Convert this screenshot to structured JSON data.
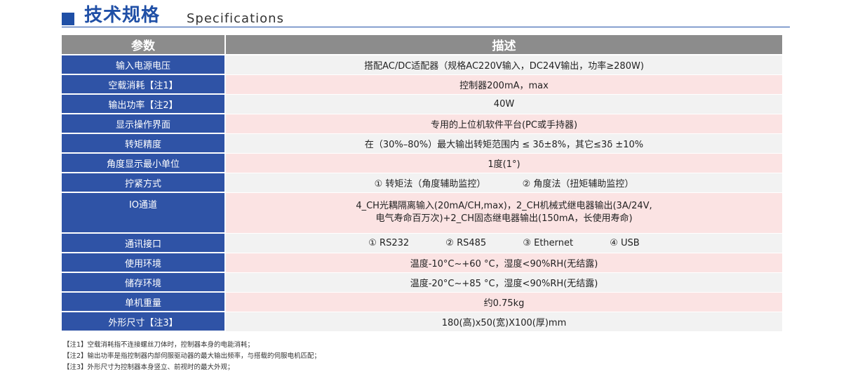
{
  "header": {
    "title_cn": "技术规格",
    "title_en": "Specifications"
  },
  "table": {
    "col_param": "参数",
    "col_desc": "描述",
    "rows": [
      {
        "param": "输入电源电压",
        "desc": "搭配AC/DC适配器（规格AC220V输入，DC24V输出，功率≥280W)"
      },
      {
        "param": "空载消耗【注1】",
        "desc": "控制器200mA，max"
      },
      {
        "param": "输出功率【注2】",
        "desc": "40W"
      },
      {
        "param": "显示操作界面",
        "desc": "专用的上位机软件平台(PC或手持器)"
      },
      {
        "param": "转矩精度",
        "desc": "在（30%–80%）最大输出转矩范围内 ≤ 3δ±8%，其它≤3δ ±10%"
      },
      {
        "param": "角度显示最小单位",
        "desc": "1度(1°)"
      },
      {
        "param": "拧紧方式",
        "options": [
          "① 转矩法（角度辅助监控）",
          "② 角度法（扭矩辅助监控）"
        ]
      },
      {
        "param": "IO通道",
        "desc_lines": [
          "4_CH光耦隔离输入(20mA/CH,max)，2_CH机械式继电器输出(3A/24V,",
          "电气寿命百万次)+2_CH固态继电器输出(150mA，长使用寿命)"
        ]
      },
      {
        "param": "通讯接口",
        "options": [
          "① RS232",
          "② RS485",
          "③ Ethernet",
          "④ USB"
        ]
      },
      {
        "param": "使用环境",
        "desc": "温度-10°C~+60 °C，湿度<90%RH(无结露)"
      },
      {
        "param": "储存环境",
        "desc": "温度-20°C~+85 °C，湿度<90%RH(无结露)"
      },
      {
        "param": "单机重量",
        "desc": "约0.75kg"
      },
      {
        "param": "外形尺寸【注3】",
        "desc": "180(高)x50(宽)X100(厚)mm"
      }
    ]
  },
  "notes": [
    "【注1】空载消耗指不连接螺丝刀体时，控制器本身的电能消耗；",
    "【注2】输出功率是指控制器内部伺服驱动器的最大输出频率，与搭载的伺服电机匹配；",
    "【注3】外形尺寸为控制器本身竖立、前视时的最大外观；"
  ],
  "colors": {
    "brand_blue": "#2f53a6",
    "header_gray": "#8c8c8c",
    "row_gray": "#f2f2f2",
    "row_pink": "#fbe3e3"
  }
}
